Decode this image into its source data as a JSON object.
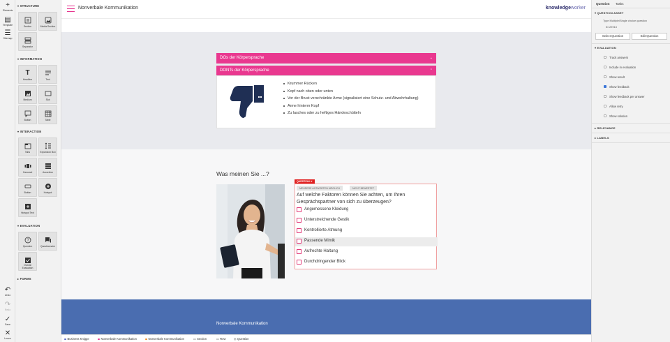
{
  "rail": {
    "top": [
      {
        "icon": "plus-icon",
        "glyph": "+",
        "label": "Elements"
      },
      {
        "icon": "template-icon",
        "glyph": "▤",
        "label": "Template"
      },
      {
        "icon": "sitemap-icon",
        "glyph": "☰",
        "label": "Sitemap"
      }
    ],
    "bottom": [
      {
        "icon": "undo-icon",
        "glyph": "↶",
        "label": "Undo"
      },
      {
        "icon": "redo-icon",
        "glyph": "↷",
        "label": "Redo"
      },
      {
        "icon": "save-icon",
        "glyph": "✓",
        "label": "Save"
      },
      {
        "icon": "leave-icon",
        "glyph": "✕",
        "label": "Leave"
      }
    ]
  },
  "elements": {
    "structure": {
      "title": "STRUCTURE",
      "items": [
        "Section",
        "Media Section",
        "Separator"
      ]
    },
    "information": {
      "title": "INFORMATION",
      "items": [
        "Headline",
        "Text",
        "Medium",
        "Slot",
        "Button",
        "Table"
      ]
    },
    "interaction": {
      "title": "INTERACTION",
      "items": [
        "Tabs",
        "Expansion Box",
        "Carousel",
        "Accordion",
        "Button",
        "Hotspot",
        "Hotspot Text"
      ]
    },
    "evaluation": {
      "title": "EVALUATION",
      "items": [
        "Question",
        "Questionnaire",
        "Overall Evaluation"
      ]
    },
    "forms": {
      "title": "FORMS"
    }
  },
  "topbar": {
    "title": "Nonverbale Kommunikation",
    "logo_a": "knowledge",
    "logo_b": "worker"
  },
  "accordion": {
    "dos_label": "DOs der Körpersprache",
    "donts_label": "DONTs der Körpersprache",
    "donts_items": [
      "Krummer Rücken",
      "Kopf nach oben oder unten",
      "Vor der Brust verschränkte Arme (signalisiert eine Schutz- und Abwehrhaltung)",
      "Arme hinterm Kopf",
      "Zu lasches oder zu heftiges Händeschütteln"
    ]
  },
  "question_section": {
    "heading": "Was meinen Sie ...?",
    "badge": "QUESTION ✕",
    "tag_multi": "MEHRERE ANTWORTEN MÖGLICH",
    "tag_nograde": "NICHT BEWERTET",
    "question": "Auf welche Faktoren können Sie achten, um Ihren Gesprächspartner von sich zu überzeugen?",
    "options": [
      "Angemessene Kleidung",
      "Unterstreichende Gestik",
      "Kontrollierte Atmung",
      "Passende Mimik",
      "Aufrechte Haltung",
      "Durchdringender Blick"
    ]
  },
  "blue_band": {
    "title": "Nonverbale Kommunikation"
  },
  "breadcrumbs": [
    {
      "label": "Business Knigge",
      "color": "#5b6cc6"
    },
    {
      "label": "Nonverbale Kommunikation",
      "color": "#e6368f"
    },
    {
      "label": "Nonverbale Kommunikation",
      "color": "#f08a24"
    },
    {
      "label": "Section",
      "color": ""
    },
    {
      "label": "Row",
      "color": ""
    },
    {
      "label": "Question",
      "color": ""
    }
  ],
  "props": {
    "tab_question": "Question",
    "tab_tasks": "Tasks",
    "sec_asset": "QUESTION ASSET",
    "type_label": "Type",
    "type_value": "Multiple/Single choice question",
    "id_label": "ID",
    "id_value": "22913",
    "btn_select": "Select Question",
    "btn_edit": "Edit Question",
    "sec_evaluation": "EVALUATION",
    "checks": [
      {
        "label": "Track answers",
        "checked": false
      },
      {
        "label": "Include in evaluation",
        "checked": false
      },
      {
        "label": "Show result",
        "checked": false
      },
      {
        "label": "Show feedback",
        "checked": true
      },
      {
        "label": "Show feedback per answer",
        "checked": false
      },
      {
        "label": "Allow retry",
        "checked": false
      },
      {
        "label": "Show solution",
        "checked": false
      }
    ],
    "sec_relevance": "RELEVANCE",
    "sec_labels": "LABELS"
  },
  "colors": {
    "accent": "#e9388f",
    "blue_band": "#4a6db0",
    "grey_band": "#e9eaee"
  }
}
